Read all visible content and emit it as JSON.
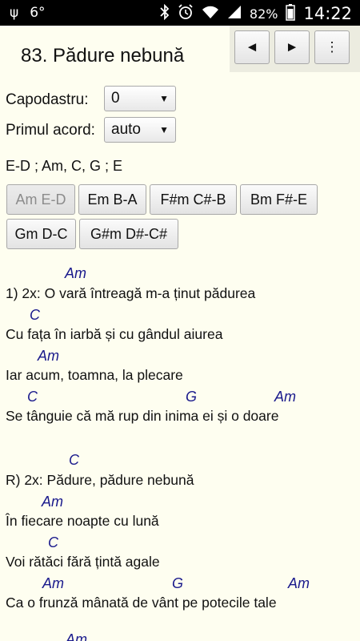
{
  "status_bar": {
    "usb": "ψ",
    "temperature": "6°",
    "icons": [
      "bluetooth-icon",
      "alarm-icon",
      "wifi-icon",
      "signal-icon",
      "battery-icon"
    ],
    "battery": "82%",
    "time": "14:22"
  },
  "song": {
    "title": "83. Pădure nebună"
  },
  "nav": {
    "prev": "◄",
    "next": "►",
    "menu": "⋮"
  },
  "settings": {
    "capo_label": "Capodastru:",
    "capo_value": "0",
    "first_chord_label": "Primul acord:",
    "first_chord_value": "auto"
  },
  "chords_used": "E-D ; Am, C, G ; E",
  "transpose_buttons": [
    "Am E-D",
    "Em B-A",
    "F#m C#-B",
    "Bm F#-E",
    "Gm D-C",
    "G#m D#-C#"
  ],
  "lyrics": [
    {
      "chords": [
        "Am"
      ],
      "text": "1) 2x: O vară întreagă m-a ținut pădurea"
    },
    {
      "chords": [
        "C"
      ],
      "text": "Cu fața în iarbă și cu gândul aiurea"
    },
    {
      "chords": [
        "Am"
      ],
      "text": "Iar acum, toamna, la plecare"
    },
    {
      "chords": [
        "C",
        "G",
        "Am"
      ],
      "text": "Se tânguie că mă rup din inima ei și o doare"
    },
    {
      "chords": [
        "C"
      ],
      "text": "R) 2x: Pădure, pădure nebună"
    },
    {
      "chords": [
        "Am"
      ],
      "text": "În fiecare noapte cu lună"
    },
    {
      "chords": [
        "C"
      ],
      "text": "Voi rătăci fără țintă agale"
    },
    {
      "chords": [
        "Am",
        "G",
        "Am"
      ],
      "text": "Ca o frunză mânată de vânt pe potecile tale"
    },
    {
      "chords": [
        "Am"
      ],
      "text": ""
    }
  ],
  "colors": {
    "background": "#FEFEF0",
    "chord": "#1A1A8C",
    "status_bar": "#000000"
  }
}
